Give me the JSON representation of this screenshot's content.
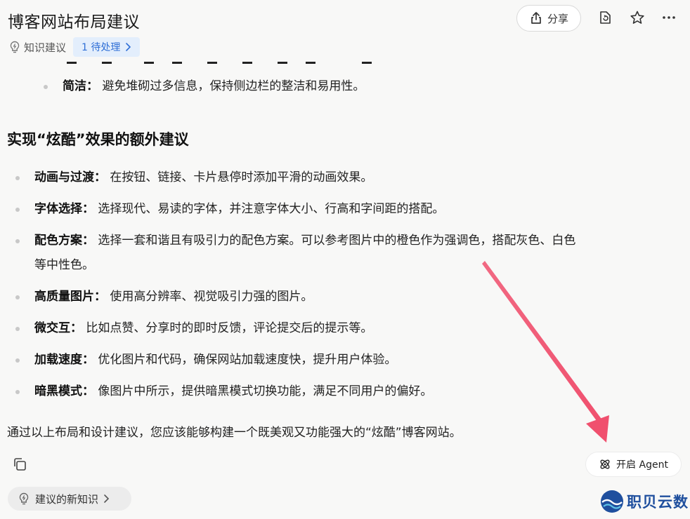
{
  "header": {
    "title": "博客网站布局建议",
    "share_label": "分享",
    "knowledge_label": "知识建议",
    "pending_badge": "1 待处理"
  },
  "content": {
    "top_item": {
      "term": "简洁：",
      "text": "避免堆砌过多信息，保持侧边栏的整洁和易用性。"
    },
    "section_heading": "实现“炫酷”效果的额外建议",
    "items": [
      {
        "term": "动画与过渡：",
        "text": "在按钮、链接、卡片悬停时添加平滑的动画效果。"
      },
      {
        "term": "字体选择：",
        "text": "选择现代、易读的字体，并注意字体大小、行高和字间距的搭配。"
      },
      {
        "term": "配色方案：",
        "text": "选择一套和谐且有吸引力的配色方案。可以参考图片中的橙色作为强调色，搭配灰色、白色",
        "text_line2": "等中性色。"
      },
      {
        "term": "高质量图片：",
        "text": "使用高分辨率、视觉吸引力强的图片。"
      },
      {
        "term": "微交互：",
        "text": "比如点赞、分享时的即时反馈，评论提交后的提示等。"
      },
      {
        "term": "加载速度：",
        "text": "优化图片和代码，确保网站加载速度快，提升用户体验。"
      },
      {
        "term": "暗黑模式：",
        "text": "像图片中所示，提供暗黑模式切换功能，满足不同用户的偏好。"
      }
    ],
    "summary": "通过以上布局和设计建议，您应该能够构建一个既美观又功能强大的“炫酷”博客网站。"
  },
  "footer": {
    "agent_label": "开启 Agent",
    "new_knowledge_label": "建议的新知识"
  },
  "watermark": {
    "text": "职贝云数"
  },
  "colors": {
    "background": "#f8f8f7",
    "badge_bg": "#e3eefc",
    "badge_text": "#2f6fd6",
    "arrow": "#f0506e",
    "watermark": "#1f4f9e"
  },
  "icons": [
    "share-icon",
    "lightbulb-icon",
    "chevron-right-icon",
    "file-sync-icon",
    "star-icon",
    "more-icon",
    "copy-icon",
    "agent-icon"
  ]
}
